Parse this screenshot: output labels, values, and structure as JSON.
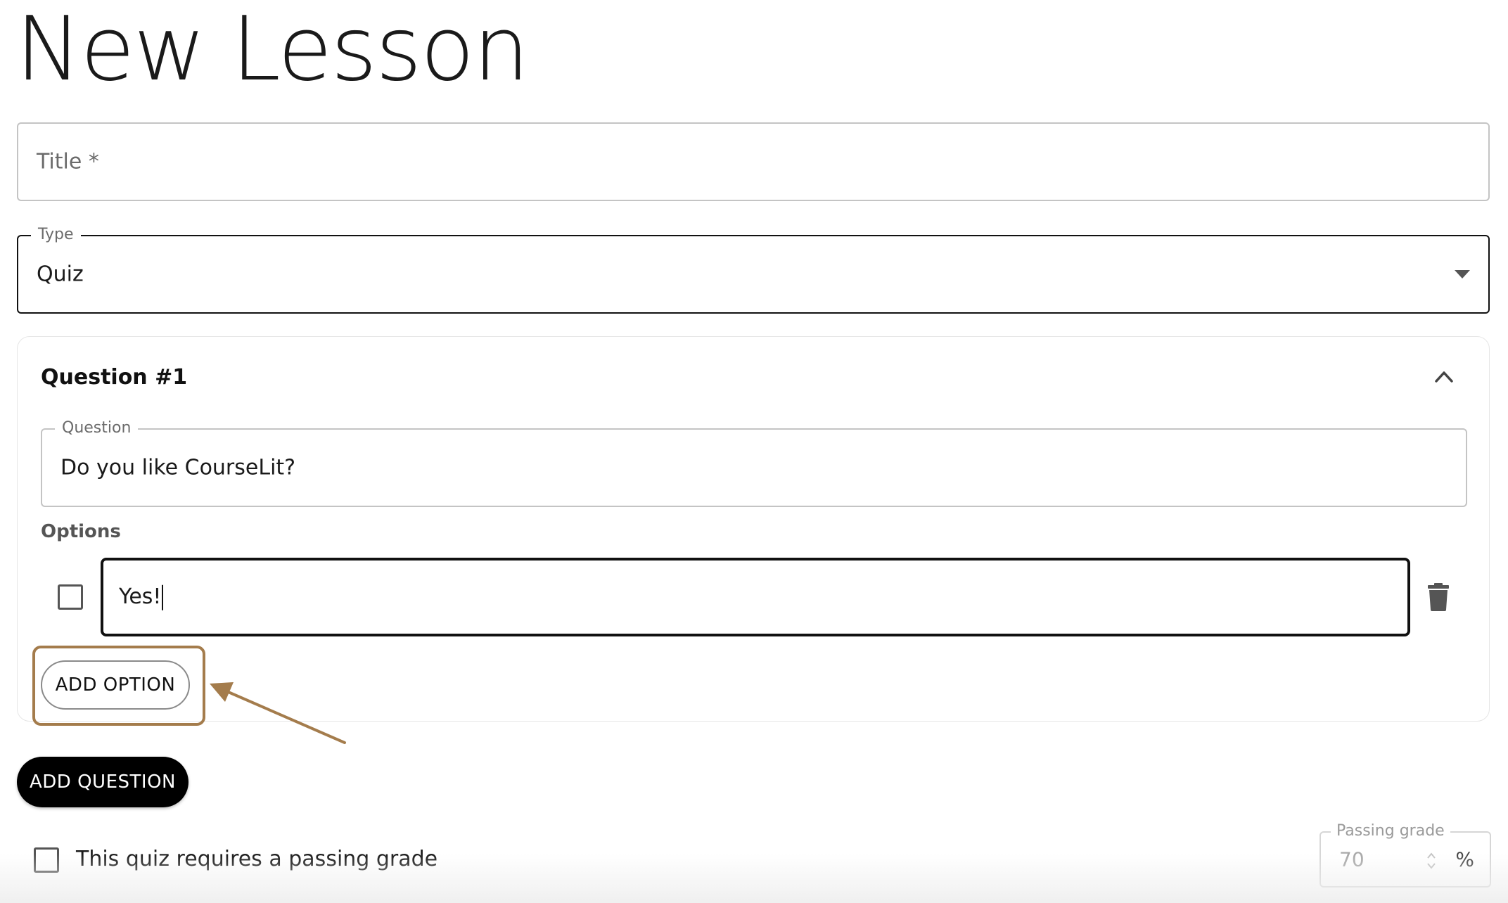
{
  "page": {
    "title": "New Lesson"
  },
  "form": {
    "title_field": {
      "placeholder": "Title *",
      "value": ""
    },
    "type_field": {
      "label": "Type",
      "value": "Quiz"
    }
  },
  "question_card": {
    "header": "Question #1",
    "question_field": {
      "label": "Question",
      "value": "Do you like CourseLit?"
    },
    "options_label": "Options",
    "options": [
      {
        "text": "Yes!",
        "correct": false
      }
    ],
    "add_option_label": "ADD OPTION"
  },
  "add_question_label": "ADD QUESTION",
  "passing_grade": {
    "checkbox_label": "This quiz requires a passing grade",
    "checked": false,
    "field_label": "Passing grade",
    "value": "70",
    "unit": "%"
  },
  "colors": {
    "annotation": "#a47c4c",
    "primary_button": "#000000",
    "border": "#c4c4c4"
  },
  "icons": [
    "chevron-up-icon",
    "trash-icon",
    "dropdown-arrow-icon",
    "spinner-icon",
    "annotation-arrow"
  ]
}
